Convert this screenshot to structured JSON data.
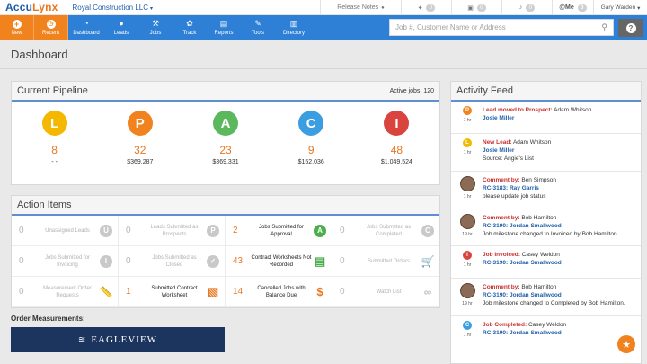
{
  "app": {
    "logo_part1": "Accu",
    "logo_part2": "Lynx",
    "company": "Royal Construction LLC",
    "company_caret": "▾"
  },
  "topbar": {
    "release_notes": "Release Notes",
    "counts": [
      "0",
      "0",
      "0"
    ],
    "me_label": "@Me",
    "me_count": "0",
    "user": "Gary Warden",
    "user_caret": "▾"
  },
  "nav": {
    "new": "New",
    "recent": "Recent",
    "items": [
      {
        "label": "Dashboard",
        "icon": "speedometer-icon",
        "glyph": "◔"
      },
      {
        "label": "Leads",
        "icon": "user-icon",
        "glyph": "●"
      },
      {
        "label": "Jobs",
        "icon": "hammer-icon",
        "glyph": "⚒"
      },
      {
        "label": "Track",
        "icon": "paw-icon",
        "glyph": "✿"
      },
      {
        "label": "Reports",
        "icon": "document-icon",
        "glyph": "▤"
      },
      {
        "label": "Tools",
        "icon": "wrench-icon",
        "glyph": "✎"
      },
      {
        "label": "Directory",
        "icon": "book-icon",
        "glyph": "▥"
      }
    ],
    "search_placeholder": "Job #, Customer Name or Address"
  },
  "page": {
    "title": "Dashboard"
  },
  "pipeline": {
    "title": "Current Pipeline",
    "active_jobs": "Active jobs: 120",
    "stages": [
      {
        "letter": "L",
        "color": "#f5b800",
        "count": "8",
        "amount": "- -"
      },
      {
        "letter": "P",
        "color": "#f0831e",
        "count": "32",
        "amount": "$369,287"
      },
      {
        "letter": "A",
        "color": "#5cb85c",
        "count": "23",
        "amount": "$369,331"
      },
      {
        "letter": "C",
        "color": "#3a9ee0",
        "count": "9",
        "amount": "$152,036"
      },
      {
        "letter": "I",
        "color": "#d9443f",
        "count": "48",
        "amount": "$1,049,524"
      }
    ]
  },
  "actions": {
    "title": "Action Items",
    "items": [
      {
        "num": "0",
        "label": "Unassigned Leads",
        "icon": "U",
        "hot": false
      },
      {
        "num": "0",
        "label": "Leads Submitted as Prospects",
        "icon": "P",
        "hot": false
      },
      {
        "num": "2",
        "label": "Jobs Submitted for Approval",
        "icon": "A",
        "hot": true
      },
      {
        "num": "0",
        "label": "Jobs Submitted as Completed",
        "icon": "C",
        "hot": false
      },
      {
        "num": "0",
        "label": "Jobs Submitted for Invoicing",
        "icon": "I",
        "hot": false
      },
      {
        "num": "0",
        "label": "Jobs Submitted as Closed",
        "icon": "✓",
        "hot": false
      },
      {
        "num": "43",
        "label": "Contract Worksheets Not Recorded",
        "icon": "▤",
        "hot": true
      },
      {
        "num": "0",
        "label": "Submitted Orders",
        "icon": "🛒",
        "hot": false
      },
      {
        "num": "0",
        "label": "Measurement Order Requests",
        "icon": "📏",
        "hot": false
      },
      {
        "num": "1",
        "label": "Submitted Contract Worksheet",
        "icon": "▧",
        "hot": true
      },
      {
        "num": "14",
        "label": "Cancelled Jobs with Balance Due",
        "icon": "$",
        "hot": true
      },
      {
        "num": "0",
        "label": "Watch List",
        "icon": "∞",
        "hot": false
      }
    ]
  },
  "order": {
    "label": "Order Measurements:",
    "vendor": "EAGLEVIEW"
  },
  "feed": {
    "title": "Activity Feed",
    "items": [
      {
        "dot": "P",
        "dot_color": "#f0831e",
        "time": "1 hr",
        "event": "Lead moved to Prospect:",
        "event_color": "red",
        "who": "Adam Whitson",
        "link": "Josie Miller",
        "extra": ""
      },
      {
        "dot": "L",
        "dot_color": "#f5b800",
        "time": "1 hr",
        "event": "New Lead:",
        "event_color": "red",
        "who": "Adam Whitson",
        "link": "Josie Miller",
        "extra": "Source: Angie's List"
      },
      {
        "dot": "",
        "dot_color": "photo",
        "time": "1 hr",
        "event": "Comment by:",
        "event_color": "red",
        "who": "Ben Simpson",
        "link": "RC-3183: Ray Garris",
        "extra": "please update job status"
      },
      {
        "dot": "",
        "dot_color": "photo",
        "time": "19 hr",
        "event": "Comment by:",
        "event_color": "red",
        "who": "Bob Hamilton",
        "link": "RC-3190: Jordan Smallwood",
        "extra": "Job milestone changed to Invoiced by Bob Hamilton."
      },
      {
        "dot": "I",
        "dot_color": "#d9443f",
        "time": "1 hr",
        "event": "Job Invoiced:",
        "event_color": "red",
        "who": "Casey Weldon",
        "link": "RC-3190: Jordan Smallwood",
        "extra": ""
      },
      {
        "dot": "",
        "dot_color": "photo",
        "time": "19 hr",
        "event": "Comment by:",
        "event_color": "red",
        "who": "Bob Hamilton",
        "link": "RC-3190: Jordan Smallwood",
        "extra": "Job milestone changed to Completed by Bob Hamilton."
      },
      {
        "dot": "C",
        "dot_color": "#3a9ee0",
        "time": "1 hr",
        "event": "Job Completed:",
        "event_color": "red",
        "who": "Casey Weldon",
        "link": "RC-3190: Jordan Smallwood",
        "extra": ""
      }
    ]
  },
  "star_glyph": "★"
}
